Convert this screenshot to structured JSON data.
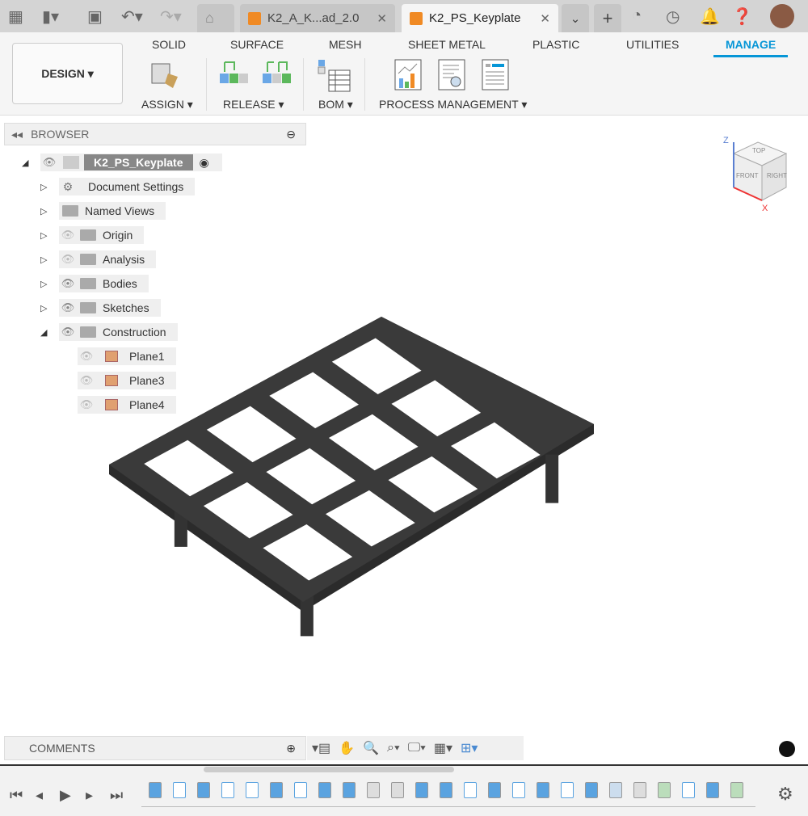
{
  "tabs": [
    {
      "label": "K2_A_K...ad_2.0",
      "active": false
    },
    {
      "label": "K2_PS_Keyplate",
      "active": true
    }
  ],
  "workspace": "DESIGN ▾",
  "ribbon_tabs": [
    "SOLID",
    "SURFACE",
    "MESH",
    "SHEET METAL",
    "PLASTIC",
    "UTILITIES",
    "MANAGE"
  ],
  "groups": [
    "ASSIGN ▾",
    "RELEASE ▾",
    "BOM ▾",
    "PROCESS MANAGEMENT ▾"
  ],
  "browser": {
    "title": "BROWSER",
    "root": "K2_PS_Keyplate",
    "items": [
      {
        "label": "Document Settings"
      },
      {
        "label": "Named Views"
      },
      {
        "label": "Origin"
      },
      {
        "label": "Analysis"
      },
      {
        "label": "Bodies"
      },
      {
        "label": "Sketches"
      },
      {
        "label": "Construction"
      }
    ],
    "planes": [
      "Plane1",
      "Plane3",
      "Plane4"
    ]
  },
  "viewcube": {
    "top": "TOP",
    "front": "FRONT",
    "right": "RIGHT",
    "z": "Z",
    "x": "X"
  },
  "comments": "COMMENTS",
  "timeline": [
    "extrude",
    "sketch",
    "extrude",
    "sketch",
    "sketch",
    "extrude",
    "sketch",
    "extrude",
    "extrude",
    "chamfer",
    "fillet",
    "extrude",
    "extrude",
    "sketch",
    "extrude",
    "sketch",
    "extrude",
    "sketch",
    "extrude",
    "delete",
    "fillet",
    "plane",
    "sketch",
    "extrude",
    "plane"
  ],
  "colors": {
    "accent": "#0696d7",
    "model": "#2b2b2b"
  }
}
